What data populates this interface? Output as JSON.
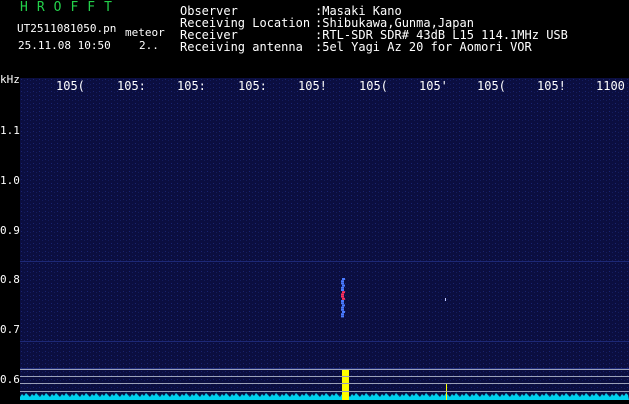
{
  "header": {
    "app_title": "HROFFT",
    "filename": "UT2511081050.pn",
    "tag": "meteor",
    "datetime": "25.11.08 10:50",
    "count": "2..",
    "info": [
      {
        "key": "Observer",
        "value": ":Masaki Kano"
      },
      {
        "key": "Receiving Location",
        "value": ":Shibukawa,Gunma,Japan"
      },
      {
        "key": "Receiver",
        "value": ":RTL-SDR SDR# 43dB L15 114.1MHz USB"
      },
      {
        "key": "Receiving antenna",
        "value": ":5el Yagi Az 20 for Aomori VOR"
      }
    ]
  },
  "spectrogram": {
    "y_unit": "kHz",
    "x_ticks": [
      "105(",
      "105:",
      "105:",
      "105:",
      "105!",
      "105(",
      "105'",
      "105(",
      "105!",
      "1100"
    ],
    "y_ticks": [
      "1.1",
      "1.0",
      "0.9",
      "0.8",
      "0.7",
      "0.6"
    ],
    "colors": {
      "background": "#0a0c3a",
      "signal": "#ffff00",
      "spectrum": "#00e5ff",
      "meteor": "#ff3060"
    }
  }
}
